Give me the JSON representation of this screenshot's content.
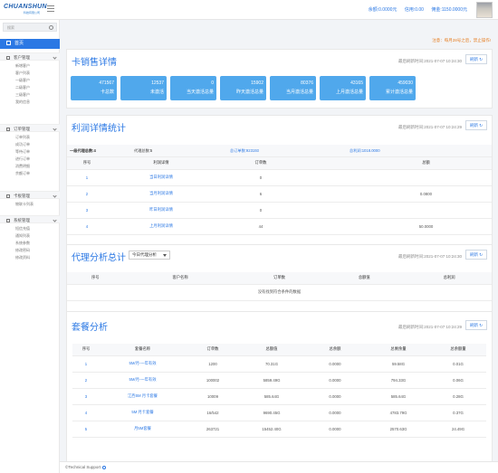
{
  "app": {
    "logo_main": "CHUANSHUN",
    "logo_sub": "科技有限公司"
  },
  "topbar": {
    "balance": "余额:0.0000元",
    "credit": "信用:0.00",
    "commission": "佣金:1150.0000元"
  },
  "sidebar": {
    "search_placeholder": "搜索",
    "home": "首页",
    "groups": [
      {
        "label": "客户管理",
        "items": [
          "新增客户",
          "客户列表",
          "一级客户",
          "二级客户",
          "三级客户",
          "我的信息"
        ]
      },
      {
        "label": "订单管理",
        "items": [
          "订单列表",
          "成功订单",
          "等待订单",
          "进行订单",
          "消费明细",
          "余额订单"
        ]
      },
      {
        "label": "卡板管理",
        "items": [
          "物联卡列表"
        ]
      },
      {
        "label": "系统管理",
        "items": [
          "短信充值",
          "通知列表",
          "系统参数",
          "修改密码",
          "修改资料"
        ]
      }
    ]
  },
  "notice": "注意：每月28号之后，禁止操作!",
  "card_sales": {
    "title": "卡销售详情",
    "updated": "最后刷新时间:2021-07-07 10:24:30",
    "refresh": "刷新",
    "cards": [
      {
        "value": "471567",
        "label": "卡总数"
      },
      {
        "value": "12537",
        "label": "未激活"
      },
      {
        "value": "0",
        "label": "当天激活总量"
      },
      {
        "value": "15902",
        "label": "昨天激活总量"
      },
      {
        "value": "80376",
        "label": "当月激活总量"
      },
      {
        "value": "43165",
        "label": "上月激活总量"
      },
      {
        "value": "459030",
        "label": "累计激活总量"
      }
    ]
  },
  "profit": {
    "title": "利润详情统计",
    "updated": "最后刷新时间:2021-07-07 10:24:29",
    "refresh": "刷新",
    "summary": {
      "agents": "一级代理总数:4",
      "agent_orders": "代理总数:5",
      "orders": "总订单数:923193",
      "profit": "总利润:1018.0000"
    },
    "headers": [
      "序号",
      "利润详情",
      "订单数",
      "",
      "总额"
    ],
    "rows": [
      {
        "idx": "1",
        "name": "当日利润详情",
        "orders": "0",
        "amount": ""
      },
      {
        "idx": "2",
        "name": "当月利润详情",
        "orders": "6",
        "amount": "0.0800"
      },
      {
        "idx": "3",
        "name": "昨日利润详情",
        "orders": "0",
        "amount": ""
      },
      {
        "idx": "4",
        "name": "上月利润详情",
        "orders": "44",
        "amount": "50.0000"
      }
    ]
  },
  "agent": {
    "title": "代理分析总计",
    "select": "今日代理分析",
    "updated": "最后刷新时间:2021-07-07 10:24:30",
    "refresh": "刷新",
    "headers": [
      "序号",
      "客户名称",
      "订单数",
      "总额值",
      "总利润"
    ],
    "empty": "没有找到符合条件的数据"
  },
  "package": {
    "title": "套餐分析",
    "updated": "最后刷新时间:2021-07-07 10:24:29",
    "refresh": "刷新",
    "headers": [
      "序号",
      "套餐名称",
      "订单数",
      "总额值",
      "总余额",
      "总剩余量",
      "总余额量"
    ],
    "rows": [
      {
        "idx": "1",
        "name": "5M/月-一年有效",
        "orders": "1200",
        "v1": "70.31G",
        "v2": "0.0000",
        "v3": "59.58G",
        "v4": "0.01G"
      },
      {
        "idx": "2",
        "name": "5M/月-一年有效",
        "orders": "100002",
        "v1": "5859.49G",
        "v2": "0.0000",
        "v3": "794.33G",
        "v4": "0.06G"
      },
      {
        "idx": "3",
        "name": "江西5M 月卡套餐",
        "orders": "10009",
        "v1": "585.64G",
        "v2": "0.0000",
        "v3": "585.64G",
        "v4": "0.28G"
      },
      {
        "idx": "4",
        "name": "5M 月卡套餐",
        "orders": "16/542",
        "v1": "9690.45G",
        "v2": "0.0000",
        "v3": "4783.79G",
        "v4": "0.37G"
      },
      {
        "idx": "5",
        "name": "月5M套餐",
        "orders": "263721",
        "v1": "15452.40G",
        "v2": "0.0000",
        "v3": "2570.63G",
        "v4": "24.49G"
      }
    ]
  },
  "footer": "©Technical Support"
}
